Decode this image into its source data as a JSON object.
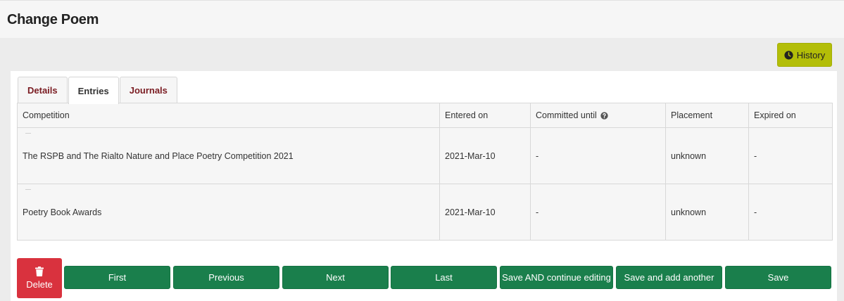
{
  "page": {
    "title": "Change Poem"
  },
  "toolbar": {
    "history_label": "History",
    "history_icon": "clock-icon"
  },
  "tabs": [
    {
      "label": "Details",
      "active": false
    },
    {
      "label": "Entries",
      "active": true
    },
    {
      "label": "Journals",
      "active": false
    }
  ],
  "table": {
    "headers": [
      "Competition",
      "Entered on",
      "Committed until",
      "Placement",
      "Expired on"
    ],
    "rows": [
      [
        "The RSPB and The Rialto Nature and Place Poetry Competition 2021",
        "2021-Mar-10",
        "-",
        "unknown",
        "-"
      ],
      [
        "Poetry Book Awards",
        "2021-Mar-10",
        "-",
        "unknown",
        "-"
      ]
    ]
  },
  "actions": {
    "delete_label": "Delete",
    "first_label": "First",
    "previous_label": "Previous",
    "next_label": "Next",
    "last_label": "Last",
    "save_continue_label": "Save AND continue editing",
    "save_add_label": "Save and add another",
    "save_label": "Save"
  },
  "colors": {
    "primary_green": "#1a7f4c",
    "danger_red": "#d9323e",
    "history_olive": "#b3be08",
    "tab_link_maroon": "#7a1c22"
  }
}
